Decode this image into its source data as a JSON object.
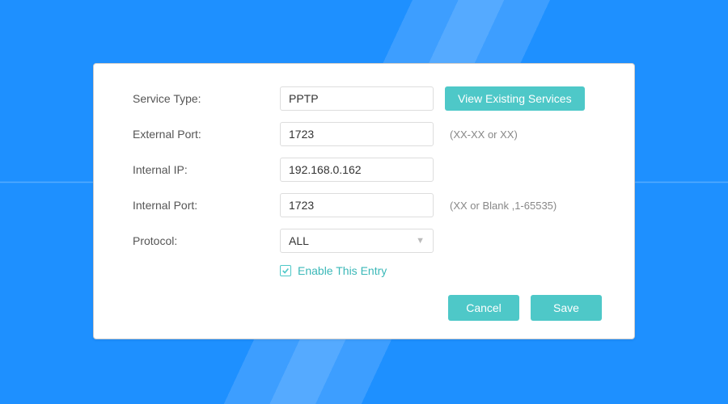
{
  "form": {
    "serviceType": {
      "label": "Service Type:",
      "value": "PPTP"
    },
    "viewExistingBtn": "View Existing Services",
    "externalPort": {
      "label": "External Port:",
      "value": "1723",
      "hint": "(XX-XX or XX)"
    },
    "internalIp": {
      "label": "Internal IP:",
      "value": "192.168.0.162"
    },
    "internalPort": {
      "label": "Internal Port:",
      "value": "1723",
      "hint": "(XX or Blank ,1-65535)"
    },
    "protocol": {
      "label": "Protocol:",
      "value": "ALL"
    },
    "enableEntry": {
      "label": "Enable This Entry",
      "checked": true
    }
  },
  "actions": {
    "cancel": "Cancel",
    "save": "Save"
  }
}
